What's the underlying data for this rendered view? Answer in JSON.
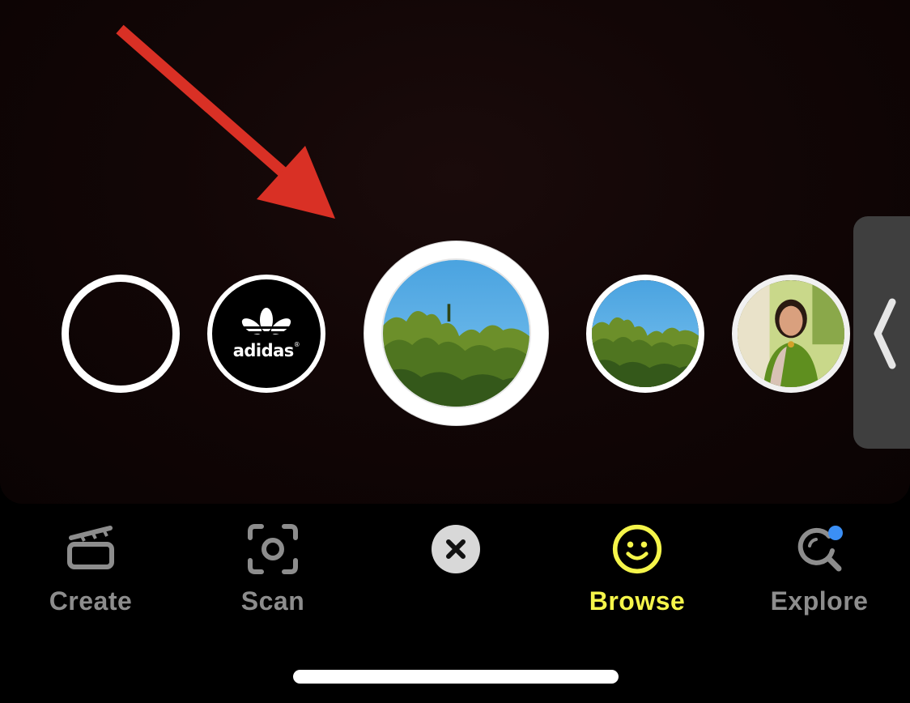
{
  "lens_carousel": {
    "items": [
      {
        "name": "empty-lens",
        "label": ""
      },
      {
        "name": "adidas-lens",
        "label": "adidas",
        "registered_mark": "®"
      },
      {
        "name": "selected-tree-lens",
        "label": ""
      },
      {
        "name": "tree-lens",
        "label": ""
      },
      {
        "name": "portrait-lens",
        "label": ""
      }
    ],
    "selected_index": 2
  },
  "bottom_nav": {
    "items": [
      {
        "label": "Create",
        "icon": "create-clapper-icon",
        "active": false
      },
      {
        "label": "Scan",
        "icon": "scan-camera-icon",
        "active": false
      },
      {
        "label": "",
        "icon": "close-icon",
        "active": false
      },
      {
        "label": "Browse",
        "icon": "smiley-icon",
        "active": true
      },
      {
        "label": "Explore",
        "icon": "explore-search-icon",
        "active": false,
        "badge": true
      }
    ]
  },
  "colors": {
    "annotation_arrow": "#d93025",
    "active_accent": "#f5f54a",
    "inactive_label": "#8d8d8d",
    "explore_badge": "#3b8ff5"
  }
}
